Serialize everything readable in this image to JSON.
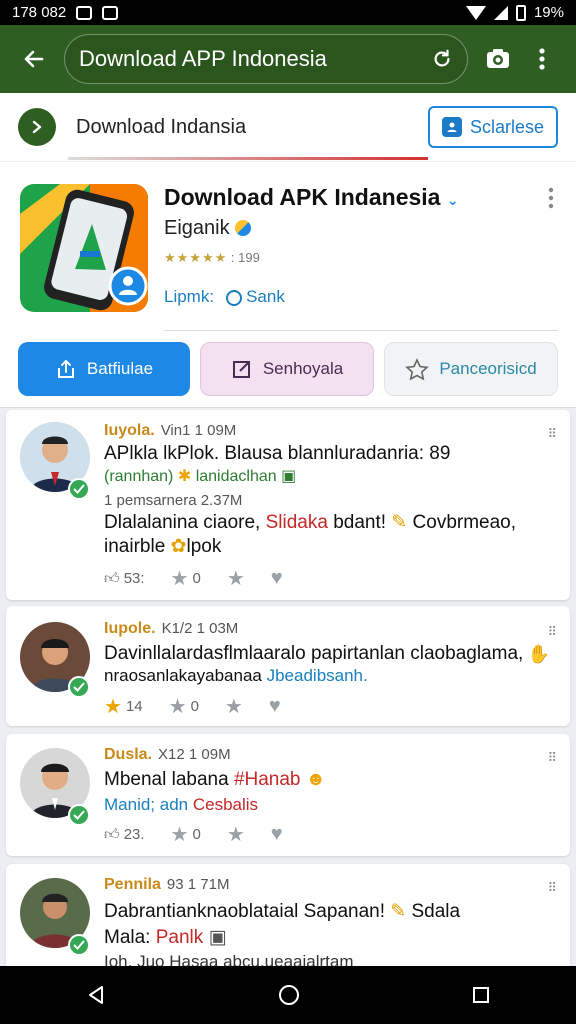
{
  "status_bar": {
    "time": "178 082",
    "battery": "19%"
  },
  "app_bar": {
    "url": "Download APP Indonesia"
  },
  "search": {
    "text": "Download Indansia",
    "button_label": "Sclarlese"
  },
  "app": {
    "title": "Download APK Indanesia",
    "developer": "Eiganik",
    "rating_stars": "★★★★★",
    "rating_count": ": 199",
    "link_1": "Lipmk:",
    "link_2": "Sank",
    "actions": [
      "Batfiulae",
      "Senhoyala",
      "Panceorisicd"
    ]
  },
  "posts": [
    {
      "name": "Iuyola.",
      "meta": "Vin1 1 09M",
      "more": "⠿",
      "line1": "APlkla lkPlok. Blausa blannluradanria:  89",
      "line2_a": "(rannhan)",
      "line2_b": "lanidaclhan",
      "sub": "1 pemsarnera 2.37M",
      "line3_a": "Dlalalanina ciaore,",
      "line3_b": "Slidaka",
      "line3_c": "bdant!",
      "line3_d": "Covbrmeao,",
      "line4": "inairble",
      "line4_b": "lpok",
      "likes": "53:",
      "stars": "0"
    },
    {
      "name": "Iupole.",
      "meta": "K1/2 1 03M",
      "more": "⠿",
      "line1": "Davinllalardasflmlaaralo papirtanlan claobaglama,",
      "line2_a": "nraosanlakayabanaa",
      "line2_b": "Jbeadibsanh.",
      "likes": "14",
      "stars": "0"
    },
    {
      "name": "Dusla.",
      "meta": "X12 1 09M",
      "more": "⠿",
      "line1_a": "Mbenal labana",
      "line1_b": "#Hanab",
      "line2_a": "Manid; adn",
      "line2_b": "Cesbalis",
      "likes": "23.",
      "stars": "0"
    },
    {
      "name": "Pennila",
      "meta": "93 1 71M",
      "more": "⠿",
      "line1_a": "Dabrantianknaoblataial Sapanan!",
      "line1_b": "Sdala",
      "line2_a": "Mala:",
      "line2_b": "Panlk",
      "line3": "Ioh. Juo Hasaa abcu.ueaaialrtam"
    }
  ],
  "colors": {
    "app_bar": "#2f5e22",
    "accent_blue": "#1e88e5",
    "verified": "#34a853"
  }
}
